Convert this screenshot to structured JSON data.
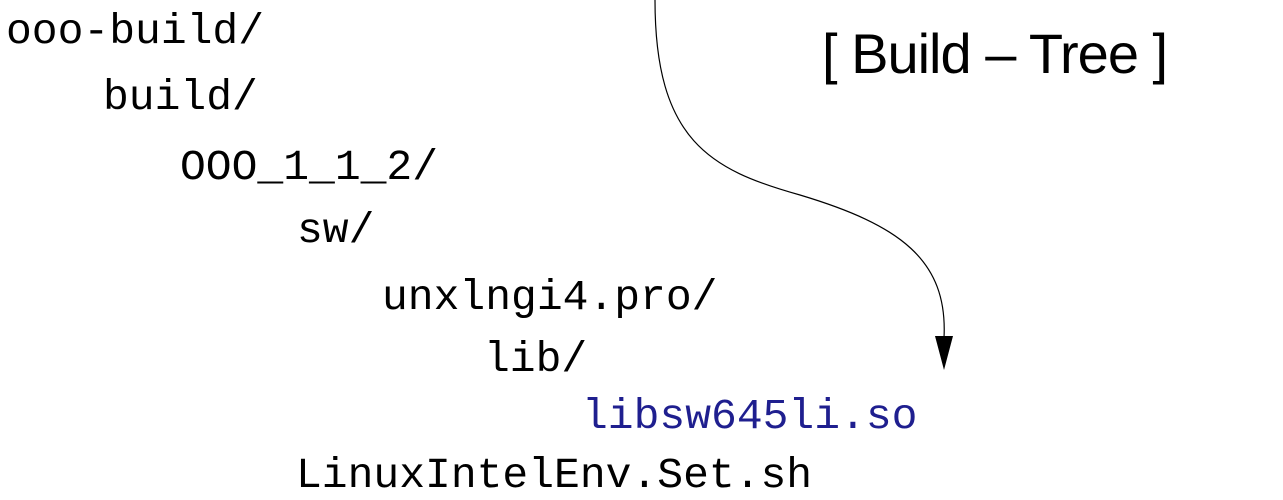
{
  "title": "[ Build – Tree ]",
  "tree": {
    "lines": [
      "ooo-build/",
      "build/",
      "OOO_1_1_2/",
      "sw/",
      "unxlngi4.pro/",
      "lib/",
      "libsw645li.so",
      "LinuxIntelEnv.Set.sh"
    ]
  },
  "colors": {
    "text": "#000000",
    "highlight": "#1f1f8f",
    "background": "#ffffff"
  }
}
